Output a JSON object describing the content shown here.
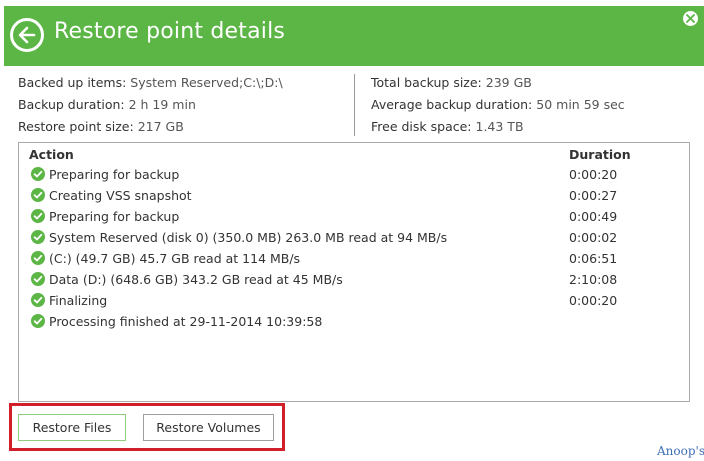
{
  "header": {
    "title": "Restore point details",
    "back_icon": "back-arrow-icon",
    "close_icon": "close-icon",
    "color": "#5cb646"
  },
  "stats": {
    "left": [
      {
        "label": "Backed up items:",
        "value": "System Reserved;C:\\;D:\\"
      },
      {
        "label": "Backup duration:",
        "value": "2 h 19 min"
      },
      {
        "label": "Restore point size:",
        "value": "217 GB"
      }
    ],
    "right": [
      {
        "label": "Total backup size:",
        "value": "239 GB"
      },
      {
        "label": "Average backup duration:",
        "value": "50 min 59 sec"
      },
      {
        "label": "Free disk space:",
        "value": "1.43 TB"
      }
    ]
  },
  "table": {
    "columns": {
      "action": "Action",
      "duration": "Duration"
    },
    "rows": [
      {
        "action": "Preparing for backup",
        "duration": "0:00:20"
      },
      {
        "action": "Creating VSS snapshot",
        "duration": "0:00:27"
      },
      {
        "action": "Preparing for backup",
        "duration": "0:00:49"
      },
      {
        "action": "System Reserved (disk 0) (350.0 MB) 263.0 MB read at 94 MB/s",
        "duration": "0:00:02"
      },
      {
        "action": " (C:) (49.7 GB) 45.7 GB read at 114 MB/s",
        "duration": "0:06:51"
      },
      {
        "action": "Data (D:) (648.6 GB) 343.2 GB read at 45 MB/s",
        "duration": "2:10:08"
      },
      {
        "action": "Finalizing",
        "duration": "0:00:20"
      },
      {
        "action": "Processing finished at 29-11-2014 10:39:58",
        "duration": ""
      }
    ],
    "status_icon": "check-circle-icon",
    "status_color": "#5cb646"
  },
  "buttons": {
    "restore_files": "Restore Files",
    "restore_volumes": "Restore Volumes",
    "highlight_color": "#d11f2a"
  },
  "watermark": "Anoop's"
}
